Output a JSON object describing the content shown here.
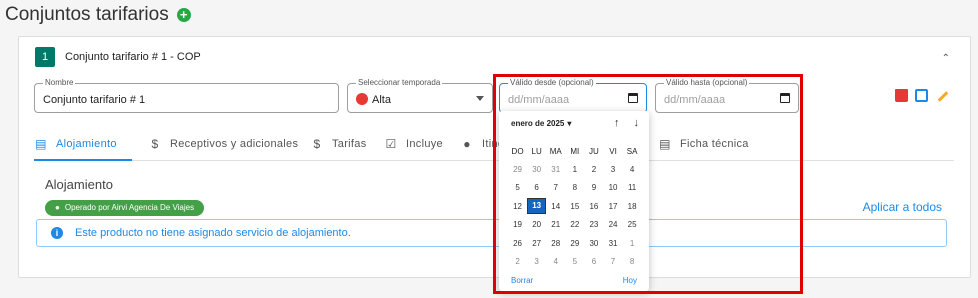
{
  "page_title": "Conjuntos tarifarios",
  "card": {
    "number": "1",
    "title": "Conjunto tarifario # 1 - COP"
  },
  "fields": {
    "nombre": {
      "label": "Nombre",
      "value": "Conjunto tarifario # 1"
    },
    "temporada": {
      "label": "Seleccionar temporada",
      "value": "Alta"
    },
    "desde": {
      "label": "Válido desde (opcional)",
      "placeholder": "dd/mm/aaaa"
    },
    "hasta": {
      "label": "Válido hasta (opcional)",
      "placeholder": "dd/mm/aaaa"
    }
  },
  "tabs": [
    {
      "label": "Alojamiento",
      "icon": "bed-icon"
    },
    {
      "label": "Receptivos y adicionales",
      "icon": "dollar-icon"
    },
    {
      "label": "Tarifas",
      "icon": "dollar-icon"
    },
    {
      "label": "Incluye",
      "icon": "checkbox-icon"
    },
    {
      "label": "Itiner",
      "icon": "location-icon"
    },
    {
      "label": "Ficha técnica",
      "icon": "list-icon"
    }
  ],
  "section": {
    "title": "Alojamiento",
    "chip": "Operado por Airvi Agencia De Viajes",
    "apply_label": "Aplicar a todos",
    "info_text": "Este producto no tiene asignado servicio de alojamiento."
  },
  "datepicker": {
    "month_label": "enero de 2025",
    "weekdays": [
      "DO",
      "LU",
      "MA",
      "MI",
      "JU",
      "VI",
      "SA"
    ],
    "weeks": [
      [
        "29",
        "30",
        "31",
        "1",
        "2",
        "3",
        "4"
      ],
      [
        "5",
        "6",
        "7",
        "8",
        "9",
        "10",
        "11"
      ],
      [
        "12",
        "13",
        "14",
        "15",
        "16",
        "17",
        "18"
      ],
      [
        "19",
        "20",
        "21",
        "22",
        "23",
        "24",
        "25"
      ],
      [
        "26",
        "27",
        "28",
        "29",
        "30",
        "31",
        "1"
      ],
      [
        "2",
        "3",
        "4",
        "5",
        "6",
        "7",
        "8"
      ]
    ],
    "selected_day": "13",
    "clear_label": "Borrar",
    "today_label": "Hoy"
  },
  "colors": {
    "accent": "#1e88e5",
    "badge": "#00796b",
    "chip": "#43a047",
    "highlight": "#e00000"
  }
}
